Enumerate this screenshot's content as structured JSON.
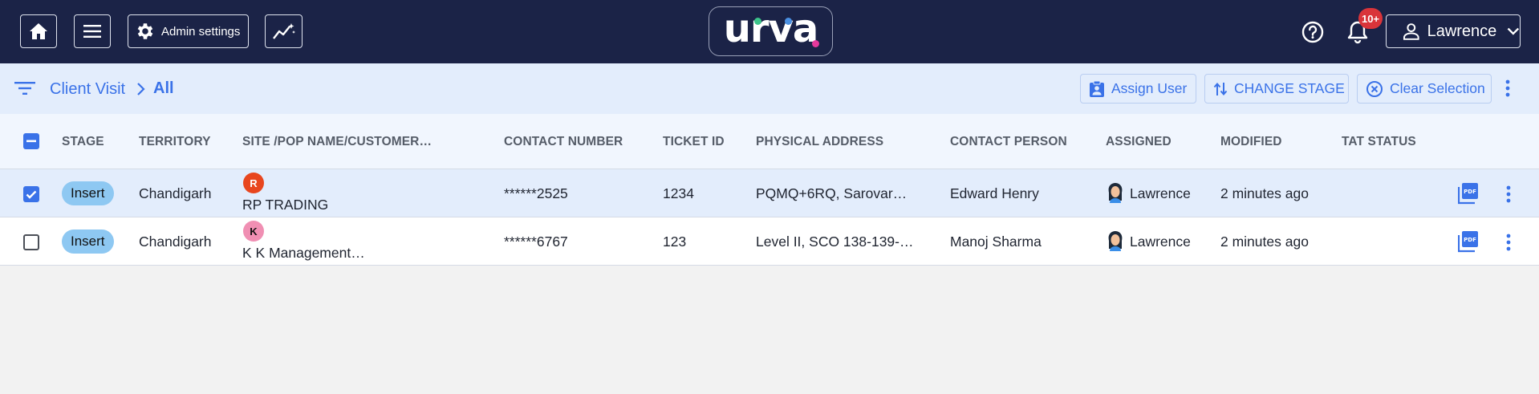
{
  "header": {
    "admin_settings_label": "Admin settings",
    "logo_text": "urva",
    "notification_badge": "10+",
    "user_name": "Lawrence",
    "icons": [
      "home-icon",
      "menu-icon",
      "gear-icon",
      "analytics-icon",
      "help-icon",
      "bell-icon",
      "user-icon",
      "chevron-down-icon"
    ]
  },
  "subheader": {
    "breadcrumb_root": "Client Visit",
    "breadcrumb_current": "All",
    "assign_user_label": "Assign User",
    "change_stage_label": "CHANGE STAGE",
    "clear_selection_label": "Clear Selection"
  },
  "table": {
    "columns": [
      "STAGE",
      "TERRITORY",
      "SITE /POP NAME/CUSTOMER…",
      "CONTACT NUMBER",
      "TICKET ID",
      "PHYSICAL ADDRESS",
      "CONTACT PERSON",
      "ASSIGNED",
      "MODIFIED",
      "TAT STATUS"
    ],
    "rows": [
      {
        "selected": true,
        "stage": "Insert",
        "territory": "Chandigarh",
        "site_initial": "R",
        "site_initial_color": "#e8461e",
        "site_name": "RP TRADING",
        "contact_number": "******2525",
        "ticket_id": "1234",
        "physical_address": "PQMQ+6RQ, Sarovar…",
        "contact_person": "Edward Henry",
        "assigned": "Lawrence",
        "modified": "2 minutes ago",
        "tat_status": ""
      },
      {
        "selected": false,
        "stage": "Insert",
        "territory": "Chandigarh",
        "site_initial": "K",
        "site_initial_color": "#f08fb3",
        "site_name": "K K Management…",
        "contact_number": "******6767",
        "ticket_id": "123",
        "physical_address": "Level II, SCO 138-139-…",
        "contact_person": "Manoj Sharma",
        "assigned": "Lawrence",
        "modified": "2 minutes ago",
        "tat_status": ""
      }
    ]
  },
  "colors": {
    "nav_bg": "#1b2347",
    "accent": "#3a72e8",
    "subheader_bg": "#e3edfc",
    "chip_bg": "#8ec8f2",
    "badge": "#d9343a"
  }
}
